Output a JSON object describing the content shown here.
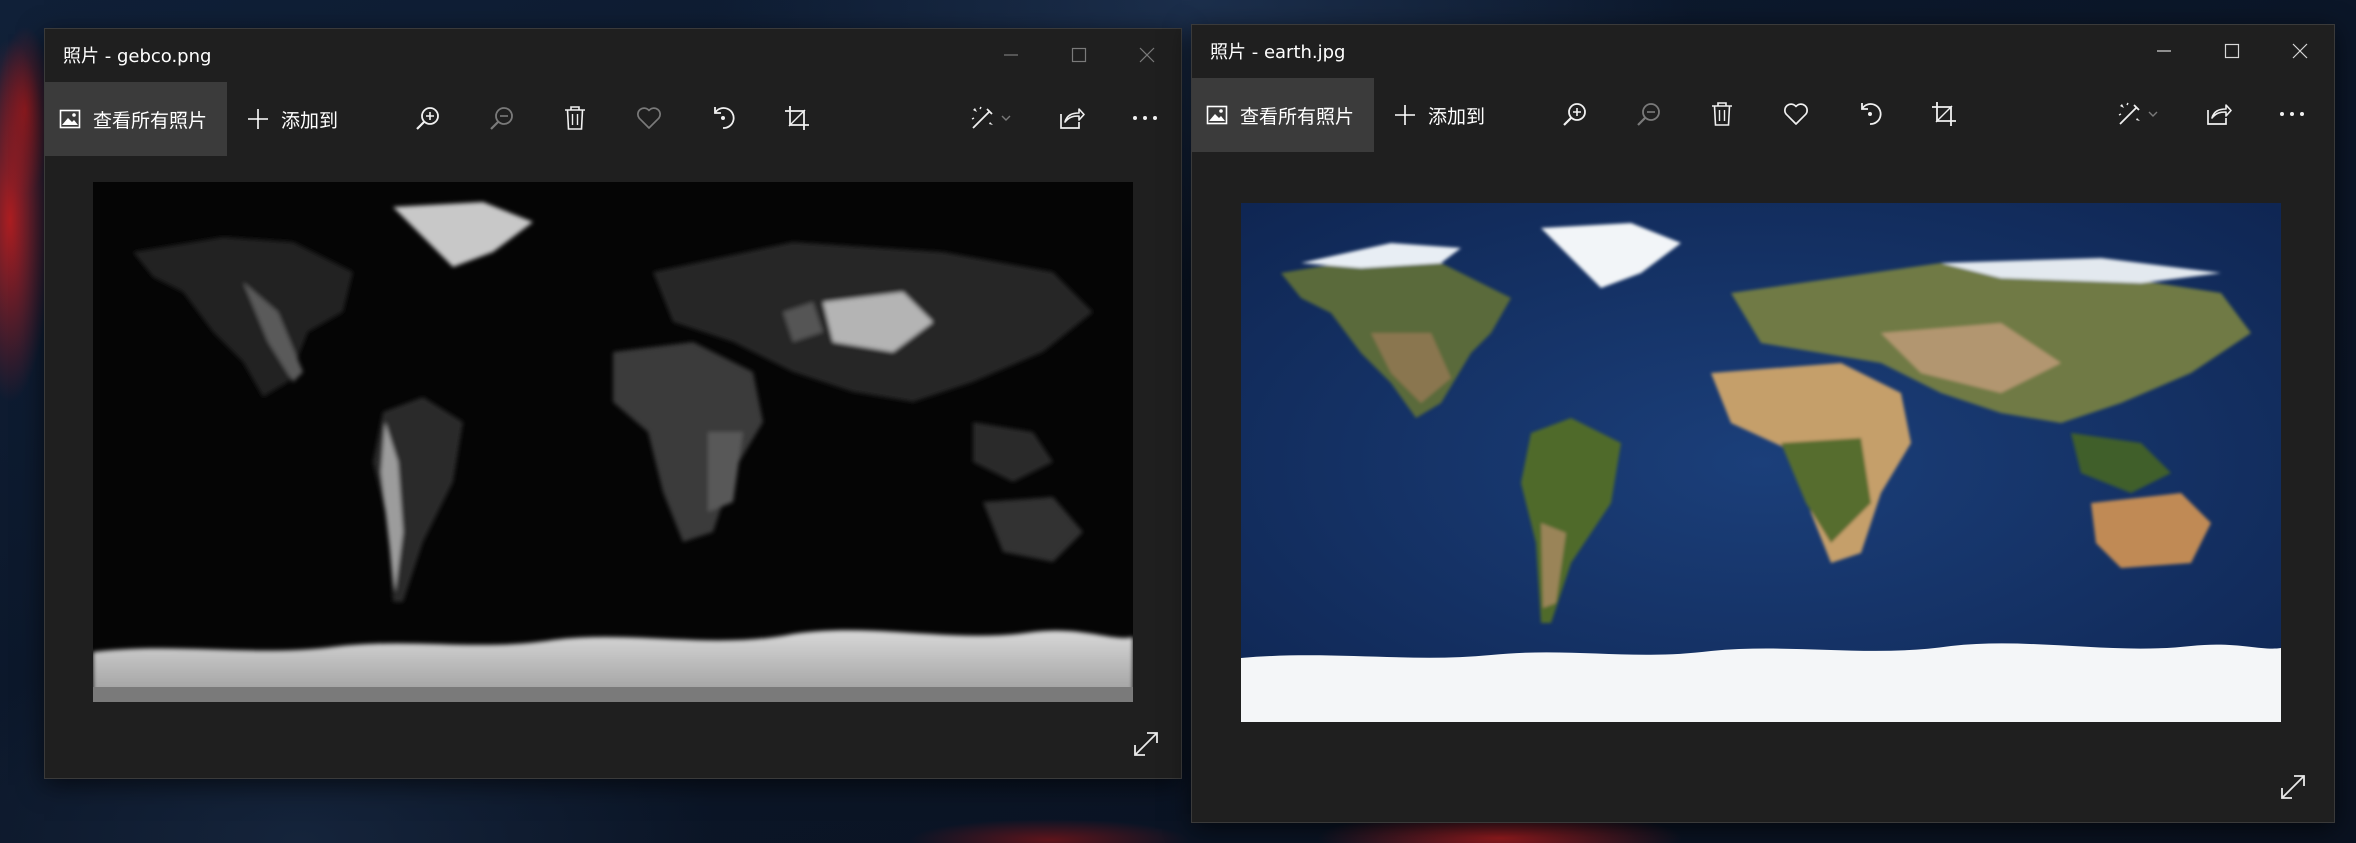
{
  "windows": [
    {
      "title": "照片 - gebco.png",
      "toolbar": {
        "view_all_label": "查看所有照片",
        "add_to_label": "添加到"
      },
      "image": {
        "file": "gebco.png",
        "style": "grayscale elevation map"
      },
      "icons": {
        "view_all": "photo-icon",
        "add_to": "plus-icon",
        "zoom_in": "zoom-in-icon",
        "zoom_out": "zoom-out-icon",
        "delete": "trash-icon",
        "favorite": "heart-icon",
        "rotate": "rotate-icon",
        "crop": "crop-icon",
        "edit": "edit-create-icon",
        "share": "share-icon",
        "more": "more-icon",
        "expand": "expand-icon"
      },
      "zoom_out_enabled": false,
      "favorite_enabled": false,
      "controls_active": false
    },
    {
      "title": "照片 - earth.jpg",
      "toolbar": {
        "view_all_label": "查看所有照片",
        "add_to_label": "添加到"
      },
      "image": {
        "file": "earth.jpg",
        "style": "color satellite map"
      },
      "icons": {
        "view_all": "photo-icon",
        "add_to": "plus-icon",
        "zoom_in": "zoom-in-icon",
        "zoom_out": "zoom-out-icon",
        "delete": "trash-icon",
        "favorite": "heart-icon",
        "rotate": "rotate-icon",
        "crop": "crop-icon",
        "edit": "edit-create-icon",
        "share": "share-icon",
        "more": "more-icon",
        "expand": "expand-icon"
      },
      "zoom_out_enabled": false,
      "favorite_enabled": true,
      "controls_active": true
    }
  ],
  "colors": {
    "window_bg": "#1f1f1f",
    "button_active_bg": "#3b3b3b",
    "text": "#ffffff",
    "disabled_icon": "#7a7a7a"
  }
}
